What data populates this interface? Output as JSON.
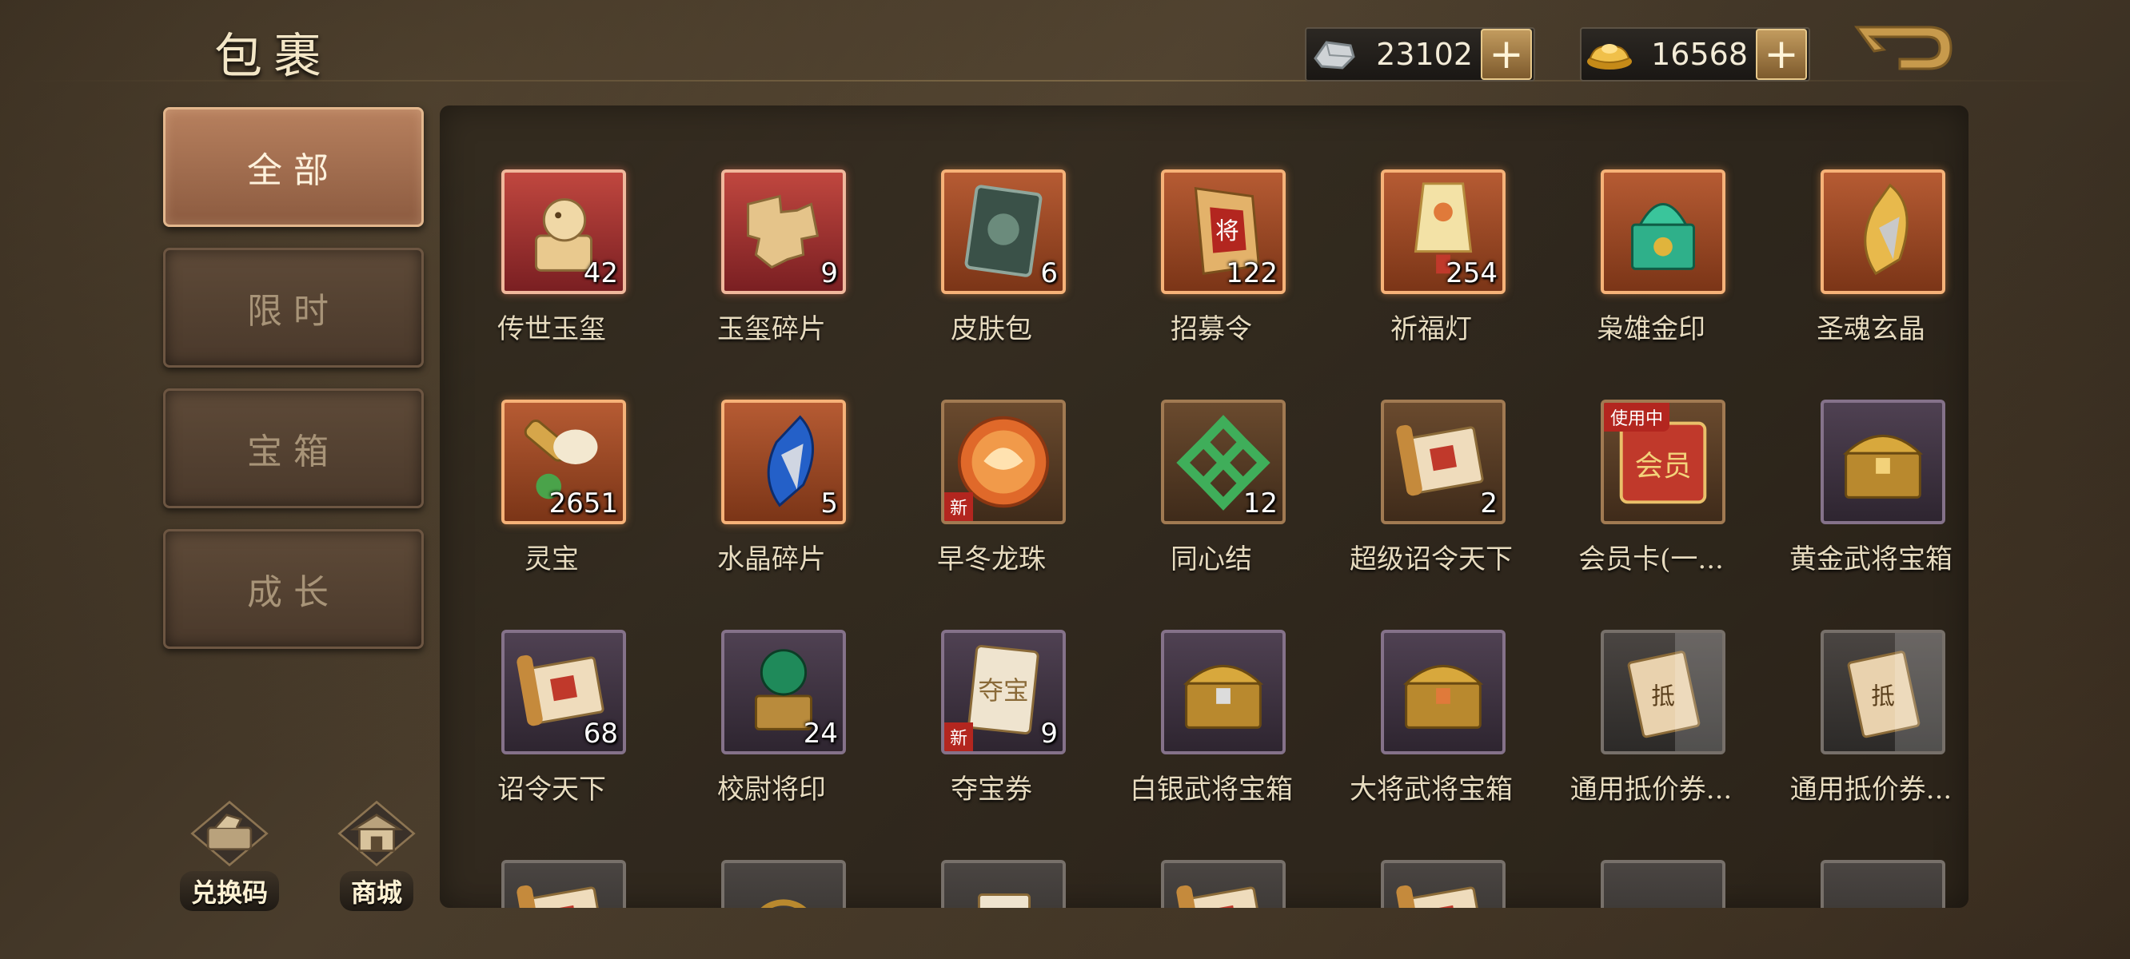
{
  "header": {
    "title": "包裹"
  },
  "currency": {
    "silver": {
      "icon": "silver-ingot-icon",
      "value": "23102"
    },
    "gold": {
      "icon": "gold-ingot-icon",
      "value": "16568"
    },
    "plus_label": "+"
  },
  "tabs": [
    {
      "label": "全部",
      "active": true
    },
    {
      "label": "限时",
      "active": false
    },
    {
      "label": "宝箱",
      "active": false
    },
    {
      "label": "成长",
      "active": false
    }
  ],
  "bottom_buttons": [
    {
      "label": "兑换码",
      "icon": "redeem-code-icon"
    },
    {
      "label": "商城",
      "icon": "shop-icon"
    }
  ],
  "items": [
    {
      "name": "传世玉玺",
      "count": "42",
      "frame": "red",
      "icon": "jade-seal-icon"
    },
    {
      "name": "玉玺碎片",
      "count": "9",
      "frame": "red",
      "icon": "seal-fragment-icon"
    },
    {
      "name": "皮肤包",
      "count": "6",
      "frame": "orange",
      "icon": "skin-pack-icon"
    },
    {
      "name": "招募令",
      "count": "122",
      "frame": "orange",
      "icon": "recruit-token-icon"
    },
    {
      "name": "祈福灯",
      "count": "254",
      "frame": "orange",
      "icon": "lantern-icon"
    },
    {
      "name": "枭雄金印",
      "count": "",
      "frame": "orange",
      "icon": "golden-seal-icon"
    },
    {
      "name": "圣魂玄晶",
      "count": "",
      "frame": "orange",
      "icon": "soul-crystal-icon"
    },
    {
      "name": "灵宝",
      "count": "2651",
      "frame": "orange",
      "icon": "spirit-treasure-icon"
    },
    {
      "name": "水晶碎片",
      "count": "5",
      "frame": "orange",
      "icon": "crystal-shard-icon"
    },
    {
      "name": "早冬龙珠",
      "count": "",
      "frame": "brown",
      "icon": "dragon-pearl-icon",
      "new": "新"
    },
    {
      "name": "同心结",
      "count": "12",
      "frame": "brown",
      "icon": "knot-icon"
    },
    {
      "name": "超级诏令天下",
      "count": "2",
      "frame": "brown",
      "icon": "scroll-icon"
    },
    {
      "name": "会员卡(一...",
      "count": "",
      "frame": "brown",
      "icon": "member-card-icon",
      "inuse": "使用中"
    },
    {
      "name": "黄金武将宝箱",
      "count": "",
      "frame": "purple",
      "icon": "gold-chest-icon"
    },
    {
      "name": "诏令天下",
      "count": "68",
      "frame": "purple",
      "icon": "scroll-icon"
    },
    {
      "name": "校尉将印",
      "count": "24",
      "frame": "purple",
      "icon": "seal-icon"
    },
    {
      "name": "夺宝券",
      "count": "9",
      "frame": "purple",
      "icon": "ticket-icon",
      "new": "新"
    },
    {
      "name": "白银武将宝箱",
      "count": "",
      "frame": "purple",
      "icon": "silver-chest-icon"
    },
    {
      "name": "大将武将宝箱",
      "count": "",
      "frame": "purple",
      "icon": "general-chest-icon"
    },
    {
      "name": "通用抵价券...",
      "count": "",
      "frame": "gray",
      "icon": "voucher-icon"
    },
    {
      "name": "通用抵价券...",
      "count": "",
      "frame": "gray",
      "icon": "voucher-icon"
    },
    {
      "name": "",
      "count": "",
      "frame": "gray",
      "icon": "scroll-icon"
    },
    {
      "name": "",
      "count": "",
      "frame": "gray",
      "icon": "ring-icon"
    },
    {
      "name": "",
      "count": "",
      "frame": "gray",
      "icon": "card-icon"
    },
    {
      "name": "",
      "count": "",
      "frame": "gray",
      "icon": "scroll-icon"
    },
    {
      "name": "",
      "count": "",
      "frame": "gray",
      "icon": "scroll-icon"
    },
    {
      "name": "",
      "count": "",
      "frame": "gray",
      "icon": "coin-icon"
    },
    {
      "name": "",
      "count": "",
      "frame": "gray",
      "icon": "jade-icon"
    }
  ]
}
